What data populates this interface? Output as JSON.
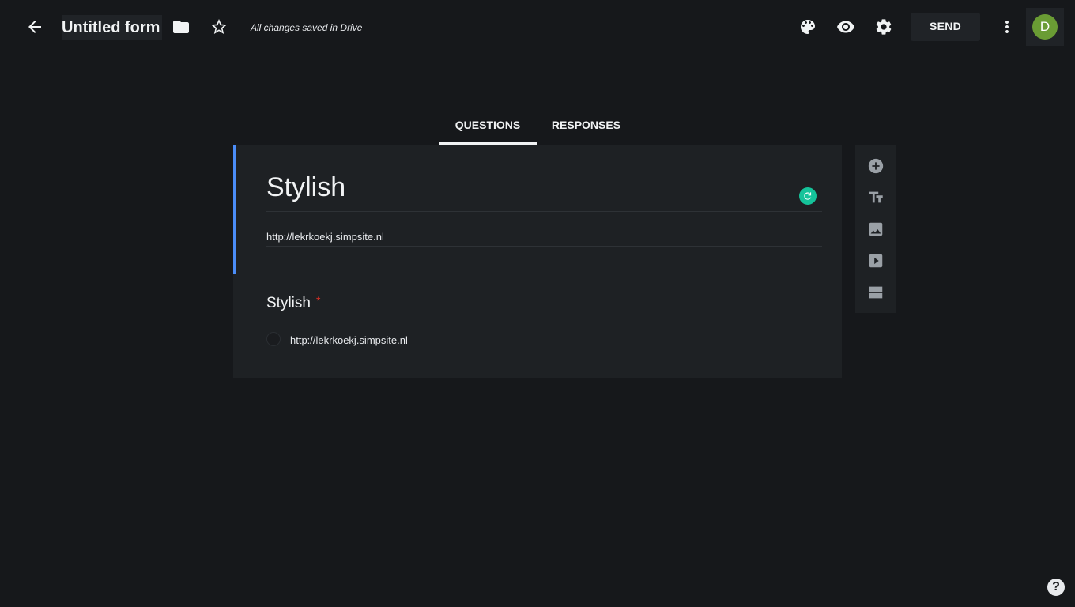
{
  "header": {
    "form_title": "Untitled form",
    "save_status": "All changes saved in Drive",
    "send_label": "SEND",
    "avatar_initial": "D",
    "icons": [
      "back-arrow-icon",
      "folder-icon",
      "star-icon",
      "palette-icon",
      "eye-icon",
      "gear-icon",
      "more-vert-icon"
    ]
  },
  "tabs": [
    {
      "label": "QUESTIONS",
      "active": true
    },
    {
      "label": "RESPONSES",
      "active": false
    }
  ],
  "form": {
    "title": "Stylish",
    "description": "http://lekrkoekj.simpsite.nl"
  },
  "question": {
    "title": "Stylish",
    "required_mark": "*",
    "options": [
      "http://lekrkoekj.simpsite.nl"
    ]
  },
  "side_toolbar": [
    "add-question-icon",
    "add-title-icon",
    "add-image-icon",
    "add-video-icon",
    "add-section-icon"
  ],
  "help_label": "?",
  "colors": {
    "background": "#16181b",
    "card": "#1e2124",
    "accent": "#4b8df8",
    "avatar": "#6a9c34",
    "required": "#d93025",
    "grammarly": "#15c39a"
  }
}
